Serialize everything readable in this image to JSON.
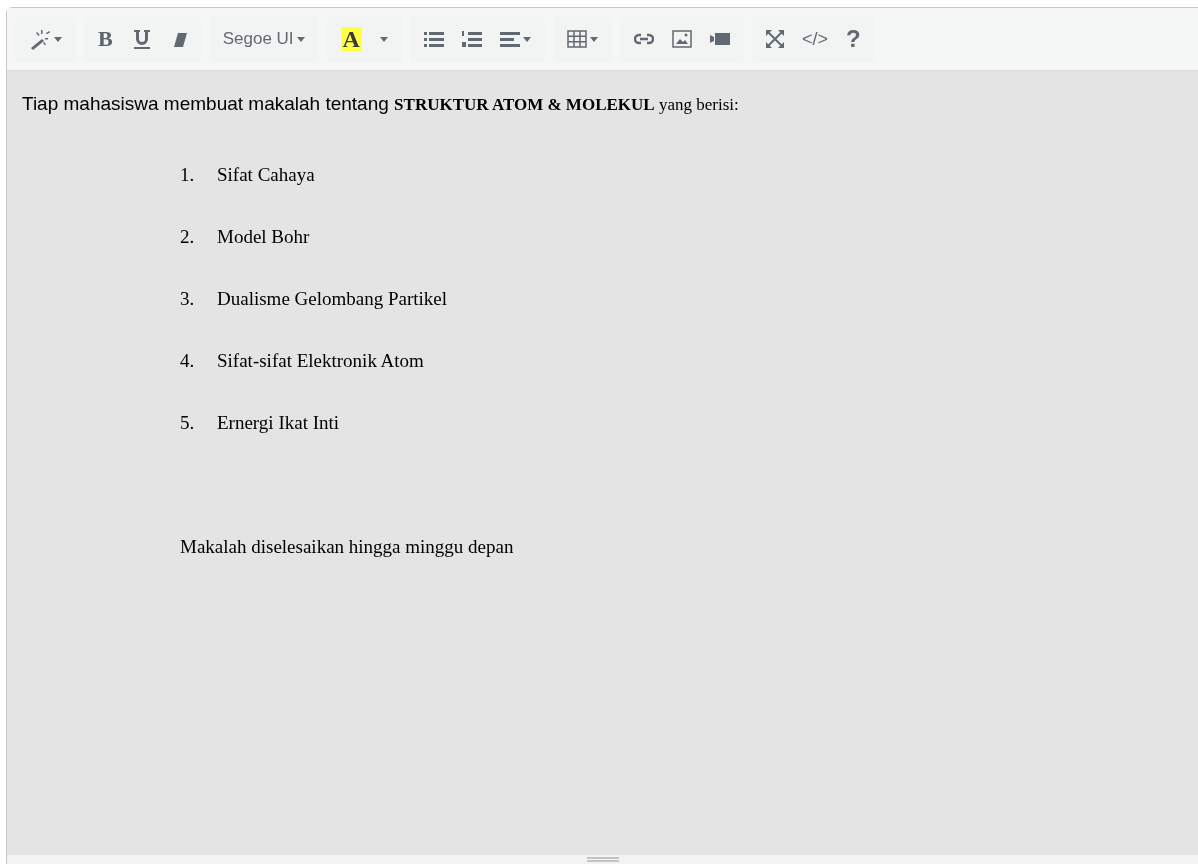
{
  "toolbar": {
    "groups": [
      {
        "buttons": [
          {
            "kind": "magic",
            "dropdown": true
          }
        ]
      },
      {
        "buttons": [
          {
            "kind": "bold",
            "label": "B"
          },
          {
            "kind": "underline"
          },
          {
            "kind": "eraser"
          }
        ]
      },
      {
        "buttons": [
          {
            "kind": "font",
            "label": "Segoe UI",
            "dropdown": true
          }
        ]
      },
      {
        "buttons": [
          {
            "kind": "color",
            "label": "A"
          },
          {
            "kind": "caret"
          }
        ]
      },
      {
        "buttons": [
          {
            "kind": "ul"
          },
          {
            "kind": "ol"
          },
          {
            "kind": "align",
            "dropdown": true
          }
        ]
      },
      {
        "buttons": [
          {
            "kind": "table",
            "dropdown": true
          }
        ]
      },
      {
        "buttons": [
          {
            "kind": "link"
          },
          {
            "kind": "image"
          },
          {
            "kind": "video"
          }
        ]
      },
      {
        "buttons": [
          {
            "kind": "fullscreen"
          },
          {
            "kind": "code",
            "label": "</>"
          },
          {
            "kind": "help",
            "label": "?"
          }
        ]
      }
    ]
  },
  "content": {
    "intro": {
      "lead": "Tiap mahasiswa membuat makalah tentang",
      "emphasis": "STRUKTUR ATOM & MOLEKUL",
      "tail": "yang berisi:"
    },
    "list": [
      {
        "number": "1.",
        "text": "Sifat Cahaya"
      },
      {
        "number": "2.",
        "text": "Model Bohr"
      },
      {
        "number": "3.",
        "text": "Dualisme Gelombang Partikel"
      },
      {
        "number": "4.",
        "text": "Sifat-sifat Elektronik Atom"
      },
      {
        "number": "5.",
        "text": "Ernergi Ikat Inti"
      }
    ],
    "closing": "Makalah diselesaikan hingga minggu depan"
  }
}
